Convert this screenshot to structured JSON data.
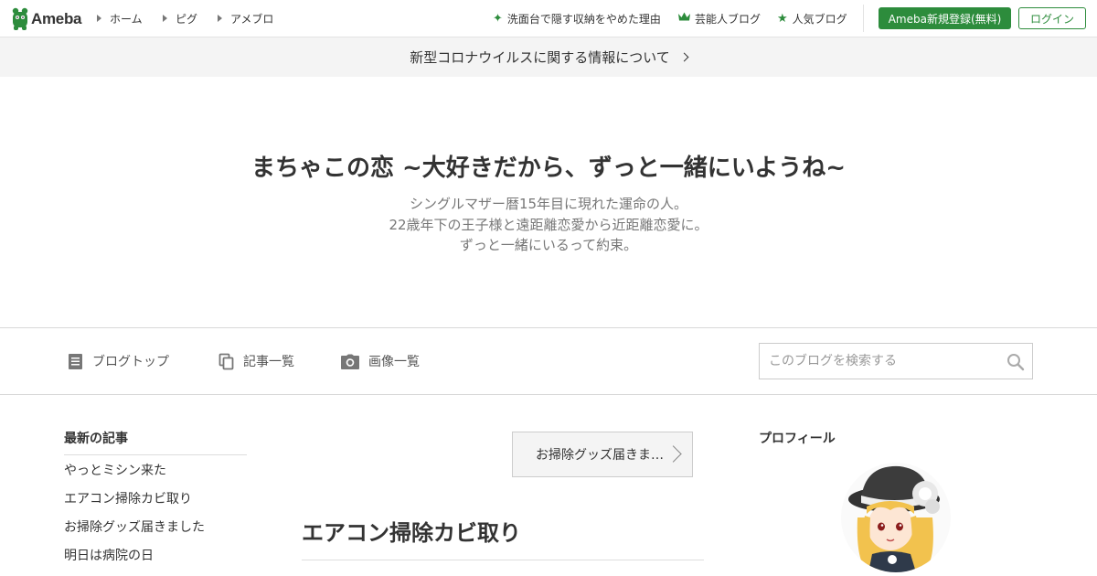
{
  "header": {
    "logo_text": "Ameba",
    "nav": [
      {
        "label": "ホーム"
      },
      {
        "label": "ピグ"
      },
      {
        "label": "アメブロ"
      }
    ],
    "links": [
      {
        "label": "洗面台で隠す収納をやめた理由",
        "icon": "sparkle-icon"
      },
      {
        "label": "芸能人ブログ",
        "icon": "crown-icon"
      },
      {
        "label": "人気ブログ",
        "icon": "star-icon"
      }
    ],
    "register_label": "Ameba新規登録(無料)",
    "login_label": "ログイン",
    "brand_color": "#2d8c3c"
  },
  "notice": {
    "text": "新型コロナウイルスに関する情報について"
  },
  "blog": {
    "title": "まちゃこの恋 ~大好きだから、ずっと一緒にいようね~",
    "description": [
      "シングルマザー暦15年目に現れた運命の人。",
      "22歳年下の王子様と遠距離恋愛から近距離恋愛に。",
      "ずっと一緒にいるって約束。"
    ]
  },
  "blog_nav": {
    "items": [
      {
        "label": "ブログトップ",
        "icon": "document-icon"
      },
      {
        "label": "記事一覧",
        "icon": "copy-icon"
      },
      {
        "label": "画像一覧",
        "icon": "camera-icon"
      }
    ],
    "search_placeholder": "このブログを検索する"
  },
  "sidebar": {
    "recent_heading": "最新の記事",
    "recent_items": [
      "やっとミシン来た",
      "エアコン掃除カビ取り",
      "お掃除グッズ届きました",
      "明日は病院の日"
    ]
  },
  "main": {
    "prev_entry_label": "お掃除グッズ届きま…",
    "entry_title": "エアコン掃除カビ取り"
  },
  "profile": {
    "heading": "プロフィール"
  }
}
